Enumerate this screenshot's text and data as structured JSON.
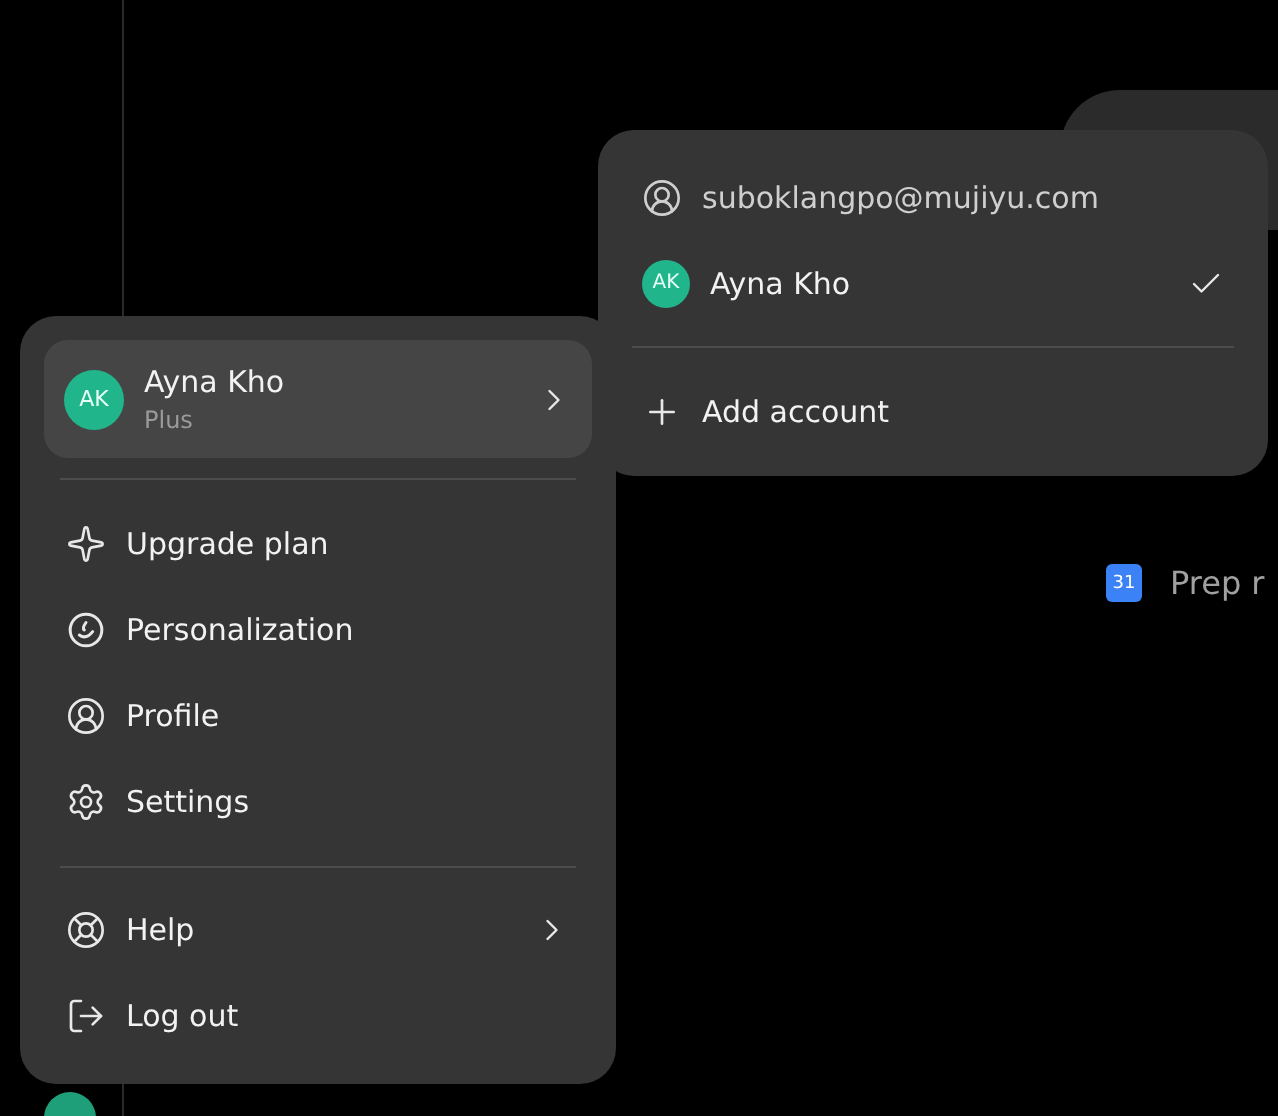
{
  "account_menu": {
    "user": {
      "initials": "AK",
      "name": "Ayna Kho",
      "plan": "Plus"
    },
    "sections": [
      [
        {
          "label": "Upgrade plan",
          "has_submenu": false
        },
        {
          "label": "Personalization",
          "has_submenu": false
        },
        {
          "label": "Profile",
          "has_submenu": false
        },
        {
          "label": "Settings",
          "has_submenu": false
        }
      ],
      [
        {
          "label": "Help",
          "has_submenu": true
        },
        {
          "label": "Log out",
          "has_submenu": false
        }
      ]
    ]
  },
  "account_switcher": {
    "email": "suboklangpo@mujiyu.com",
    "accounts": [
      {
        "initials": "AK",
        "name": "Ayna Kho",
        "selected": true
      }
    ],
    "add_label": "Add account"
  },
  "background": {
    "calendar_badge": "31",
    "event_text": "Prep r"
  }
}
